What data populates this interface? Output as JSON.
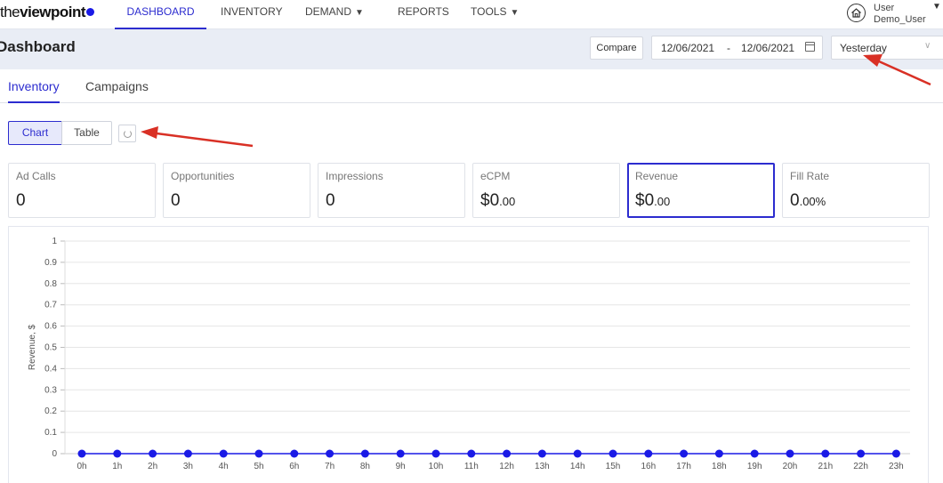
{
  "logo": {
    "prefix": "the",
    "bold": "viewpoint"
  },
  "nav": {
    "items": [
      {
        "label": "DASHBOARD",
        "active": true,
        "caret": false
      },
      {
        "label": "INVENTORY",
        "active": false,
        "caret": false
      },
      {
        "label": "DEMAND",
        "active": false,
        "caret": true
      },
      {
        "label": "REPORTS",
        "active": false,
        "caret": false
      },
      {
        "label": "TOOLS",
        "active": false,
        "caret": true
      }
    ]
  },
  "user": {
    "name": "User",
    "account": "Demo_User",
    "icon": "home-icon"
  },
  "header": {
    "title": "Dashboard",
    "compare_label": "Compare",
    "date_from": "12/06/2021",
    "date_separator": "-",
    "date_to": "12/06/2021",
    "period": "Yesterday"
  },
  "tabs": [
    {
      "label": "Inventory",
      "active": true
    },
    {
      "label": "Campaigns",
      "active": false
    }
  ],
  "view_toggle": {
    "chart_label": "Chart",
    "table_label": "Table",
    "active": "chart"
  },
  "metrics": [
    {
      "label": "Ad Calls",
      "value": "0",
      "suffix": ""
    },
    {
      "label": "Opportunities",
      "value": "0",
      "suffix": ""
    },
    {
      "label": "Impressions",
      "value": "0",
      "suffix": ""
    },
    {
      "label": "eCPM",
      "value": "$0",
      "suffix": ".00"
    },
    {
      "label": "Revenue",
      "value": "$0",
      "suffix": ".00",
      "selected": true
    },
    {
      "label": "Fill Rate",
      "value": "0",
      "suffix": ".00%"
    }
  ],
  "colors": {
    "accent": "#2c2ccf",
    "series": "#1a1ae6",
    "annotation": "#d93025",
    "header_band": "#e9edf5"
  },
  "chart_data": {
    "type": "line",
    "ylabel": "Revenue, $",
    "xlabel": "",
    "ylim": [
      0,
      1
    ],
    "yticks": [
      "0",
      "0.1",
      "0.2",
      "0.3",
      "0.4",
      "0.5",
      "0.6",
      "0.7",
      "0.8",
      "0.9",
      "1"
    ],
    "grid": true,
    "x": [
      "0h",
      "1h",
      "2h",
      "3h",
      "4h",
      "5h",
      "6h",
      "7h",
      "8h",
      "9h",
      "10h",
      "11h",
      "12h",
      "13h",
      "14h",
      "15h",
      "16h",
      "17h",
      "18h",
      "19h",
      "20h",
      "21h",
      "22h",
      "23h"
    ],
    "series": [
      {
        "values": [
          0,
          0,
          0,
          0,
          0,
          0,
          0,
          0,
          0,
          0,
          0,
          0,
          0,
          0,
          0,
          0,
          0,
          0,
          0,
          0,
          0,
          0,
          0,
          0
        ]
      }
    ]
  }
}
